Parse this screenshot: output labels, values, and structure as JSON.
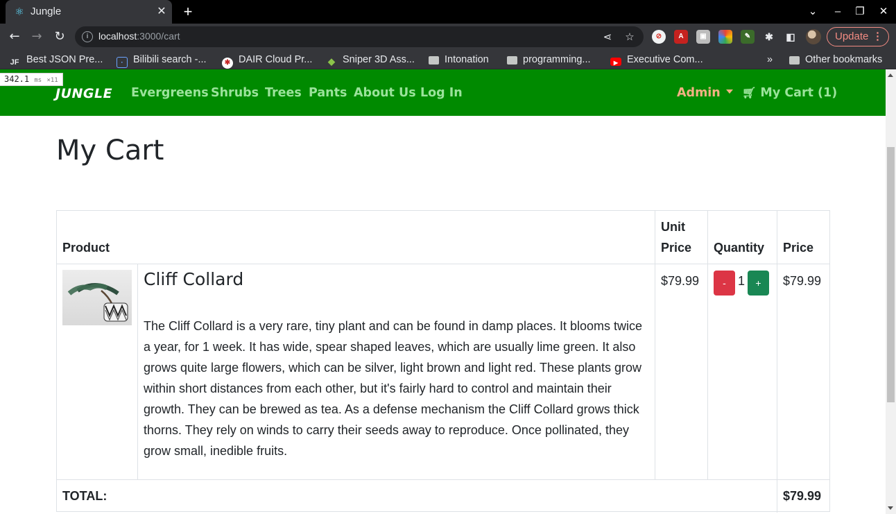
{
  "browser": {
    "tab_title": "Jungle",
    "url_host": "localhost",
    "url_rest": ":3000/cart",
    "update_label": "Update",
    "bookmarks": [
      {
        "label": "Best JSON Pre...",
        "icon": "json-icon"
      },
      {
        "label": "Bilibili search -...",
        "icon": "bilibili-icon"
      },
      {
        "label": "DAIR Cloud Pr...",
        "icon": "dair-icon"
      },
      {
        "label": "Sniper 3D Ass...",
        "icon": "android-icon"
      },
      {
        "label": "Intonation",
        "icon": "folder-icon"
      },
      {
        "label": "programming...",
        "icon": "folder-icon"
      },
      {
        "label": "Executive Com...",
        "icon": "youtube-icon"
      }
    ],
    "other_bookmarks": "Other bookmarks",
    "overflow": "»"
  },
  "perf_overlay": {
    "value": "342.1",
    "unit": "ms",
    "count": "×11"
  },
  "nav": {
    "brand": "JUNGLE",
    "links": [
      "Evergreens",
      "Shrubs",
      "Trees",
      "Pants",
      "About Us",
      "Log In"
    ],
    "admin": "Admin",
    "cart": "My Cart (1)"
  },
  "page": {
    "title": "My Cart",
    "headers": {
      "product": "Product",
      "unit_price_1": "Unit",
      "unit_price_2": "Price",
      "quantity": "Quantity",
      "price": "Price"
    },
    "items": [
      {
        "name": "Cliff Collard",
        "description": "The Cliff Collard is a very rare, tiny plant and can be found in damp places. It blooms twice a year, for 1 week. It has wide, spear shaped leaves, which are usually lime green. It also grows quite large flowers, which can be silver, light brown and light red. These plants grow within short distances from each other, but it's fairly hard to control and maintain their growth. They can be brewed as tea. As a defense mechanism the Cliff Collard grows thick thorns. They rely on winds to carry their seeds away to reproduce. Once pollinated, they grow small, inedible fruits.",
        "unit_price": "$79.99",
        "quantity": "1",
        "minus": "-",
        "plus": "+",
        "price": "$79.99"
      }
    ],
    "total_label": "TOTAL:",
    "total_value": "$79.99"
  },
  "colors": {
    "navbar": "#008a00",
    "nav_link": "#9be39b",
    "admin": "#f4b183",
    "minus_button": "#dc3545",
    "plus_button": "#198754"
  }
}
